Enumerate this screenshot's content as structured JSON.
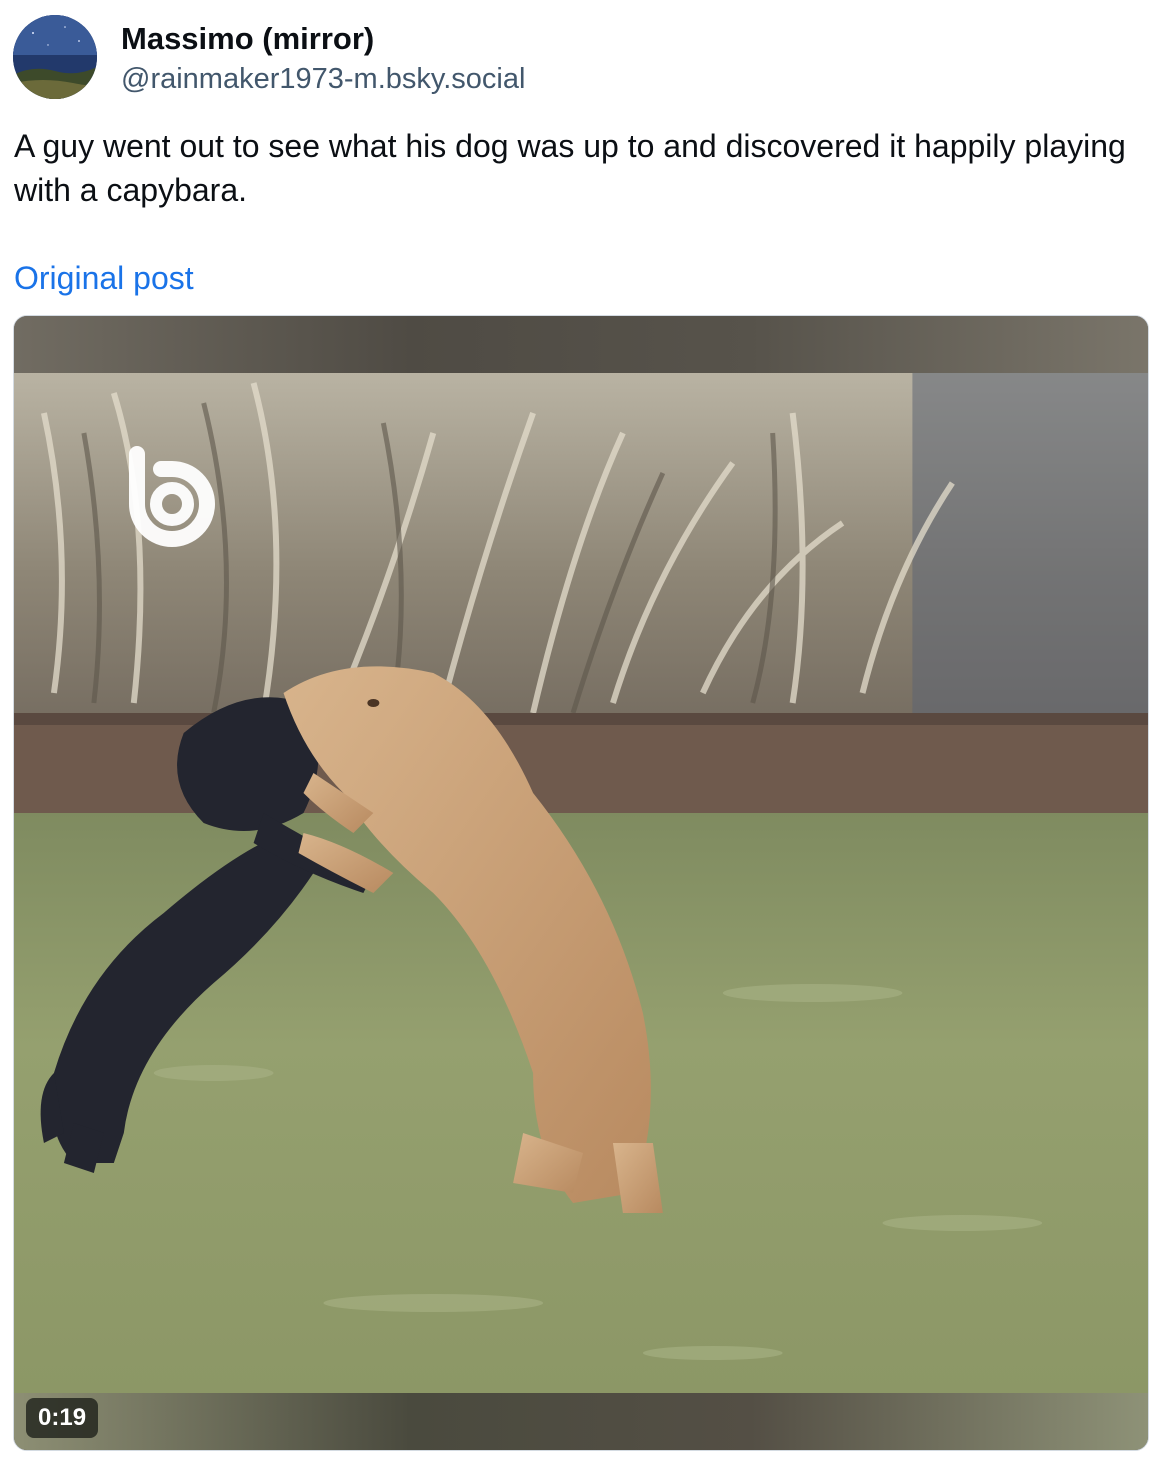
{
  "author": {
    "display_name": "Massimo (mirror)",
    "handle": "@rainmaker1973-m.bsky.social",
    "avatar_icon": "avatar-night-sky"
  },
  "post": {
    "text": "A guy went out to see what his dog was up to and discovered it happily playing with a capybara.",
    "link_label": "Original post"
  },
  "video": {
    "duration": "0:19",
    "watermark_icon": "b-logo-icon",
    "colors": {
      "grass": "#8f9a6a",
      "dog": "#23252f",
      "capybara": "#c9a27c"
    }
  }
}
